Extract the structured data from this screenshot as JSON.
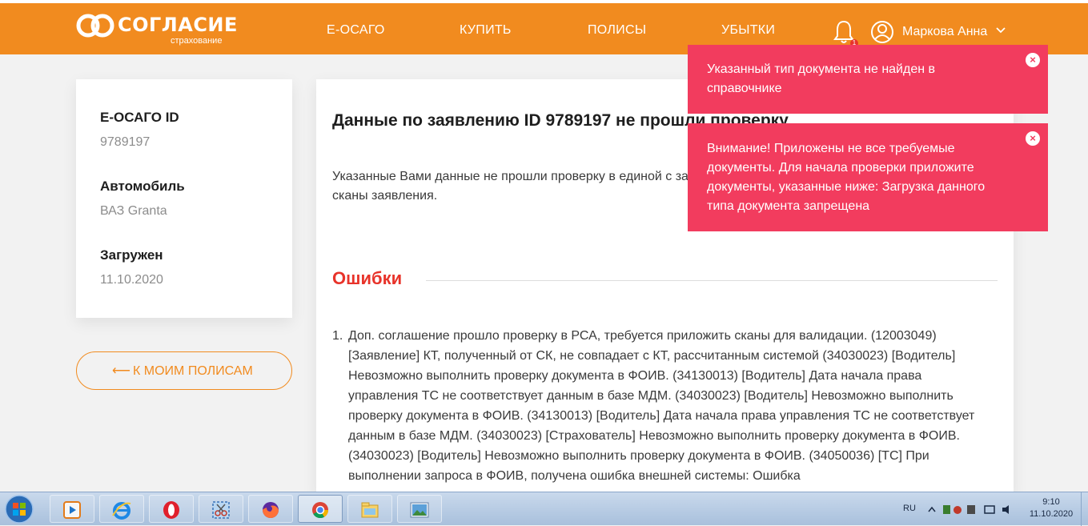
{
  "header": {
    "logo_text": "СОГЛАСИЕ",
    "logo_sub": "страхование",
    "nav": [
      "Е-ОСАГО",
      "КУПИТЬ",
      "ПОЛИСЫ",
      "УБЫТКИ"
    ],
    "notification_count": "1",
    "user_name": "Маркова Анна"
  },
  "sidebar": {
    "fields": [
      {
        "label": "Е-ОСАГО ID",
        "value": "9789197"
      },
      {
        "label": "Автомобиль",
        "value": "ВАЗ Granta"
      },
      {
        "label": "Загружен",
        "value": "11.10.2020"
      }
    ],
    "back_label": "К МОИМ ПОЛИСАМ",
    "back_arrow": "⟵"
  },
  "main": {
    "title": "Данные по заявлению ID 9789197 не прошли проверку",
    "description": "Указанные Вами данные не прошли проверку в единой с заполнения всех полей, прикрепите, пожалуйста, сканы заявления.",
    "errors_title": "Ошибки",
    "errors": [
      {
        "num": "1.",
        "text": "Доп. соглашение прошло проверку в РСА, требуется приложить сканы для валидации. (12003049) [Заявление] КТ, полученный от СК, не совпадает с КТ, рассчитанным системой (34030023) [Водитель] Невозможно выполнить проверку документа в ФОИВ. (34130013) [Водитель] Дата начала права управления ТС не соответствует данным в базе МДМ. (34030023) [Водитель] Невозможно выполнить проверку документа в ФОИВ. (34130013) [Водитель] Дата начала права управления ТС не соответствует данным в базе МДМ. (34030023) [Страхователь] Невозможно выполнить проверку документа в ФОИВ. (34030023) [Водитель] Невозможно выполнить проверку документа в ФОИВ. (34050036) [ТС] При выполнении запроса в ФОИВ, получена ошибка внешней системы: Ошибка"
      }
    ]
  },
  "toasts": [
    {
      "text": "Указанный тип документа не найден в справочнике",
      "close": "×"
    },
    {
      "text": "Внимание! Приложены не все требуемые документы. Для начала проверки приложите документы, указанные ниже: Загрузка данного типа документа запрещена",
      "close": "×"
    }
  ],
  "taskbar": {
    "apps": [
      "media-player-icon",
      "internet-explorer-icon",
      "opera-icon",
      "snipping-tool-icon",
      "firefox-icon",
      "chrome-icon",
      "file-explorer-icon",
      "image-viewer-icon"
    ],
    "lang": "RU",
    "time": "9:10",
    "date": "11.10.2020"
  },
  "colors": {
    "brand_orange": "#f18b1f",
    "error_red": "#e8332a",
    "toast_pink": "#f23c5e"
  }
}
